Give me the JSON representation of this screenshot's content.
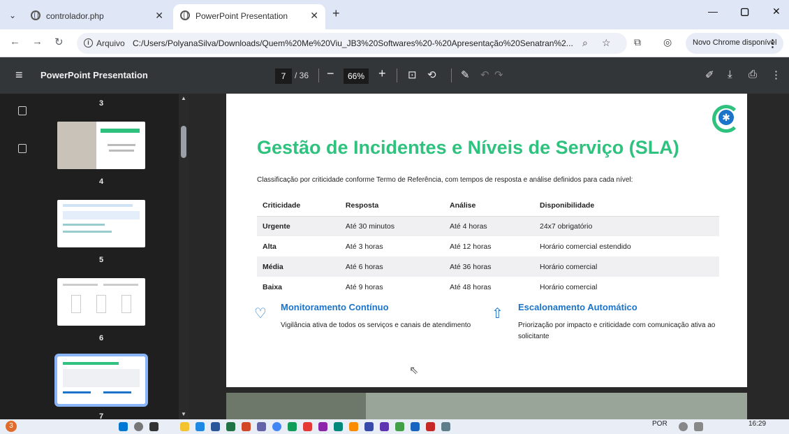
{
  "browser": {
    "tabs": [
      {
        "title": "controlador.php",
        "active": false
      },
      {
        "title": "PowerPoint Presentation",
        "active": true
      }
    ],
    "scheme_label": "Arquivo",
    "url": "C:/Users/PolyanaSilva/Downloads/Quem%20Me%20Viu_JB3%20Softwares%20-%20Apresentação%20Senatran%2...",
    "update_label": "Novo Chrome disponível"
  },
  "pdf_toolbar": {
    "title": "PowerPoint Presentation",
    "current_page": "7",
    "total_pages": "/ 36",
    "zoom": "66%"
  },
  "thumbnails": {
    "numbers": [
      "3",
      "4",
      "5",
      "6",
      "7"
    ],
    "selected": "7"
  },
  "slide": {
    "title": "Gestão de Incidentes e Níveis de Serviço (SLA)",
    "subtitle": "Classificação por criticidade conforme Termo de Referência, com tempos de resposta e análise definidos para cada nível:",
    "table": {
      "headers": [
        "Criticidade",
        "Resposta",
        "Análise",
        "Disponibilidade"
      ],
      "rows": [
        [
          "Urgente",
          "Até 30 minutos",
          "Até 4 horas",
          "24x7 obrigatório"
        ],
        [
          "Alta",
          "Até 3 horas",
          "Até 12 horas",
          "Horário comercial estendido"
        ],
        [
          "Média",
          "Até 6 horas",
          "Até 36 horas",
          "Horário comercial"
        ],
        [
          "Baixa",
          "Até 9 horas",
          "Até 48 horas",
          "Horário comercial"
        ]
      ]
    },
    "cards": [
      {
        "title": "Monitoramento Contínuo",
        "text": "Vigilância ativa de todos os serviços e canais de atendimento",
        "icon": "heartbeat-icon"
      },
      {
        "title": "Escalonamento Automático",
        "text": "Priorização por impacto e criticidade com comunicação ativa ao solicitante",
        "icon": "arrow-up-icon"
      }
    ]
  },
  "taskbar": {
    "badge": "3",
    "language": "POR",
    "time": "16:29"
  },
  "colors": {
    "accent_green": "#2ec27e",
    "accent_blue": "#1b74c9",
    "pdf_toolbar": "#323639"
  }
}
